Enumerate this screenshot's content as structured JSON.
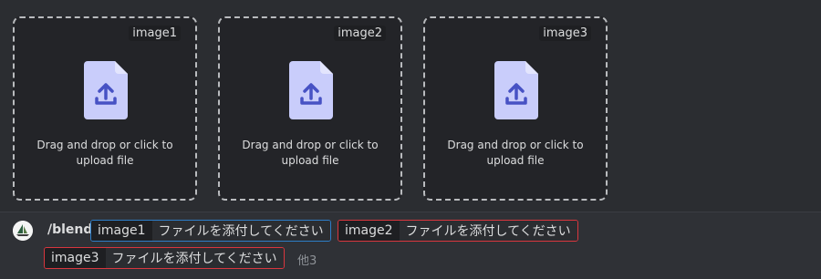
{
  "uploads": [
    {
      "tag": "image1",
      "hint_line1": "Drag and drop or click to",
      "hint_line2": "upload file"
    },
    {
      "tag": "image2",
      "hint_line1": "Drag and drop or click to",
      "hint_line2": "upload file"
    },
    {
      "tag": "image3",
      "hint_line1": "Drag and drop or click to",
      "hint_line2": "upload file"
    }
  ],
  "command": {
    "name": "/blend",
    "options": [
      {
        "key": "image1",
        "value": "ファイルを添付してください",
        "state": "focused"
      },
      {
        "key": "image2",
        "value": "ファイルを添付してください",
        "state": "error"
      },
      {
        "key": "image3",
        "value": "ファイルを添付してください",
        "state": "error"
      }
    ],
    "more": "他3"
  },
  "colors": {
    "accent_icon": "#c9cdfb",
    "focus": "#2d7dc7",
    "error": "#d9363e"
  },
  "icons": [
    "file-upload-icon",
    "sailboat-avatar-icon"
  ]
}
